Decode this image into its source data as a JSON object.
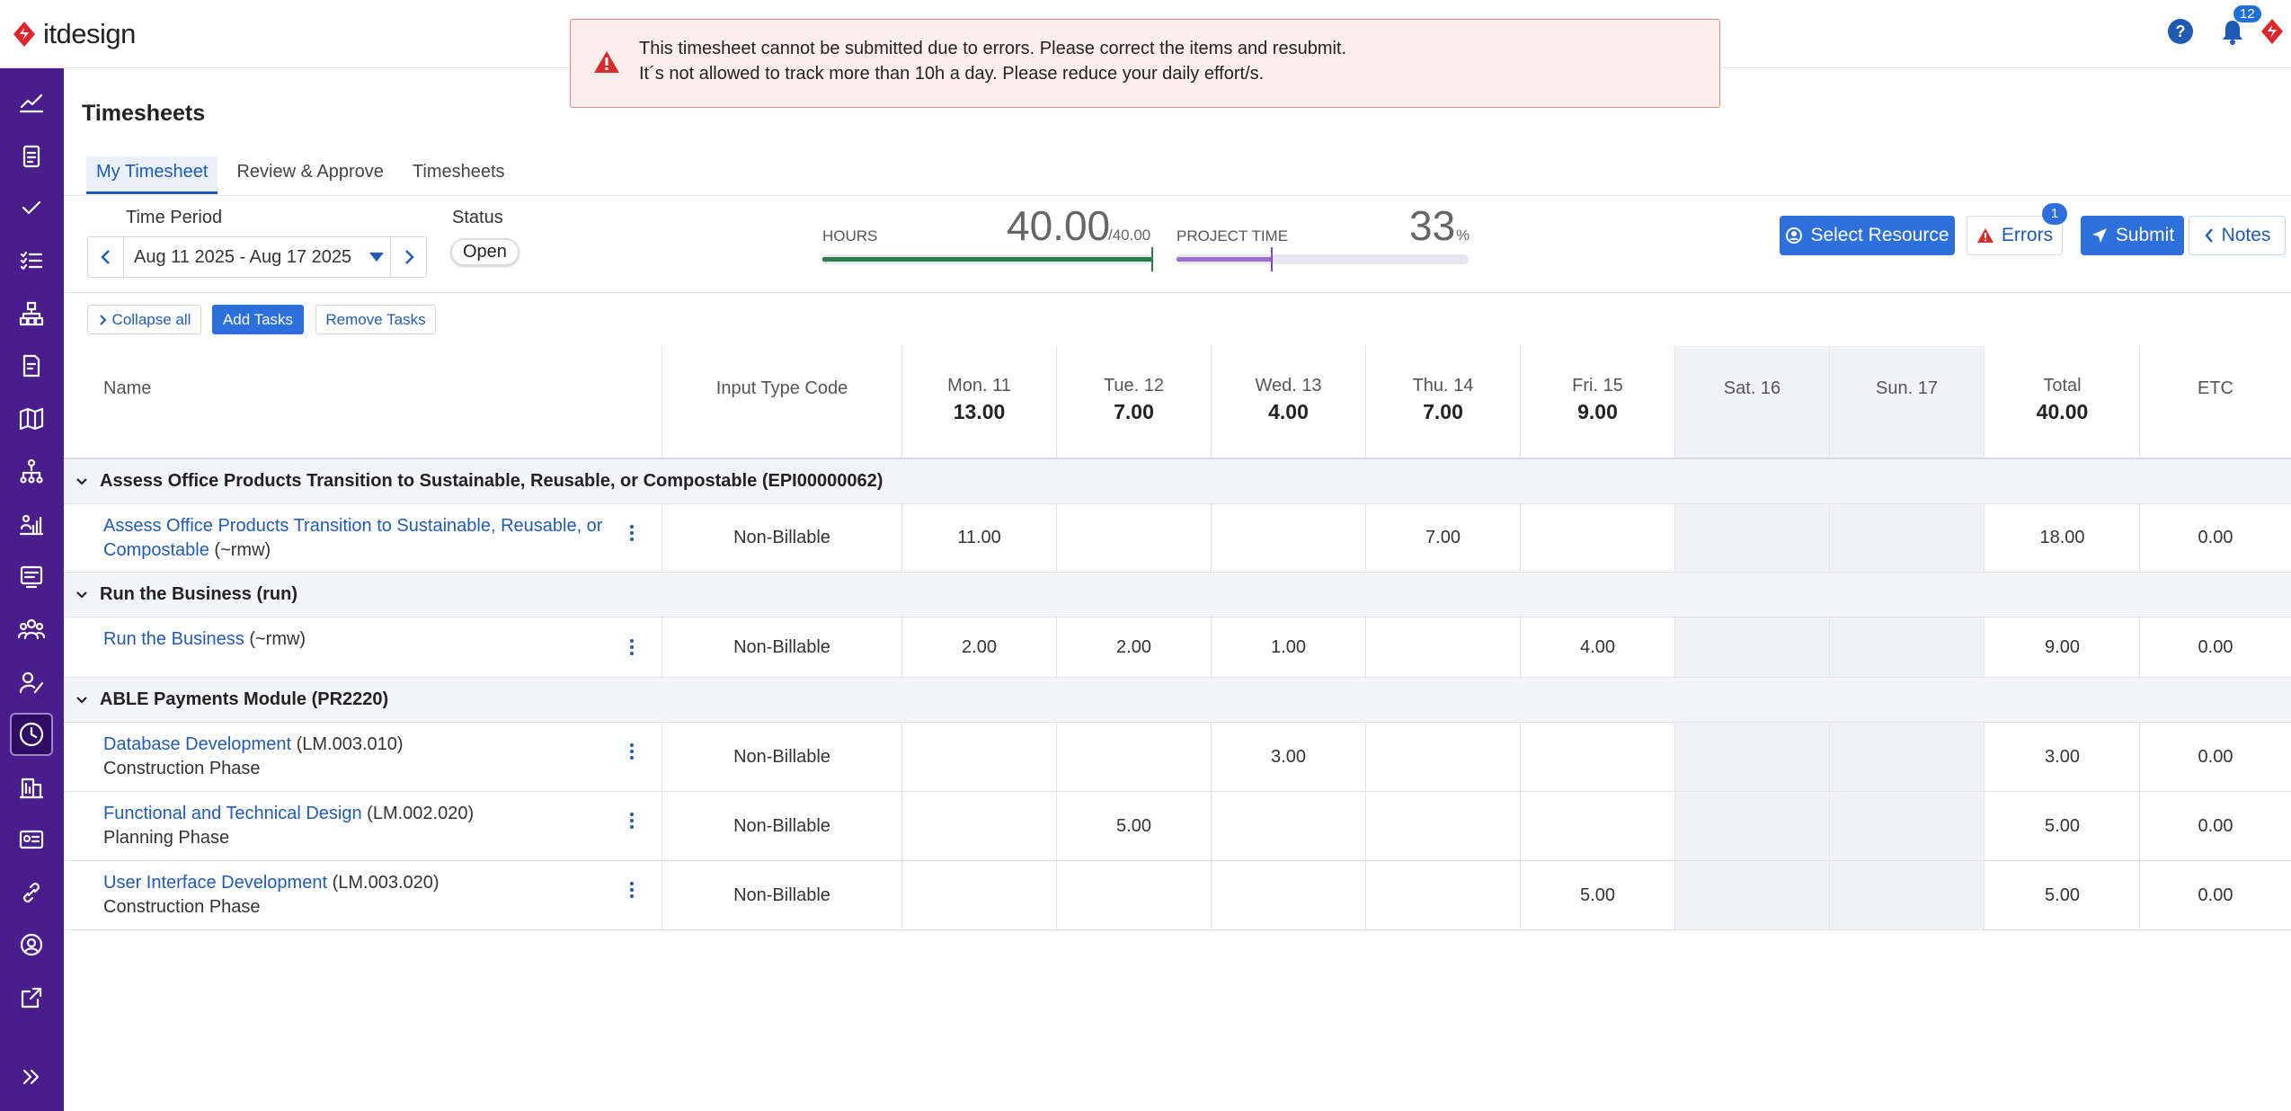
{
  "app": {
    "logo_text": "itdesign",
    "notification_count": "12"
  },
  "alert": {
    "line1": "This timesheet cannot be submitted due to errors. Please correct the items and resubmit.",
    "line2": "It´s not allowed to track more than 10h a day. Please reduce your daily effort/s."
  },
  "page": {
    "title": "Timesheets"
  },
  "tabs": [
    {
      "label": "My Timesheet",
      "active": true
    },
    {
      "label": "Review & Approve",
      "active": false
    },
    {
      "label": "Timesheets",
      "active": false
    }
  ],
  "controls": {
    "time_period_label": "Time Period",
    "time_period_value": "Aug 11 2025 - Aug 17 2025",
    "status_label": "Status",
    "status_value": "Open",
    "hours_label": "HOURS",
    "hours_value": "40.00",
    "hours_max": "/40.00",
    "hours_fraction": 1.0,
    "project_time_label": "PROJECT TIME",
    "project_time_value": "33",
    "project_time_unit": "%",
    "project_time_fraction": 0.33,
    "select_resource": "Select Resource",
    "errors": "Errors",
    "errors_count": "1",
    "submit": "Submit",
    "notes": "Notes",
    "collapse_all": "Collapse all",
    "add_tasks": "Add Tasks",
    "remove_tasks": "Remove Tasks"
  },
  "columns": {
    "name": "Name",
    "input_type": "Input Type Code",
    "days": [
      {
        "day": "Mon. 11",
        "total": "13.00"
      },
      {
        "day": "Tue. 12",
        "total": "7.00"
      },
      {
        "day": "Wed. 13",
        "total": "4.00"
      },
      {
        "day": "Thu. 14",
        "total": "7.00"
      },
      {
        "day": "Fri. 15",
        "total": "9.00"
      },
      {
        "day": "Sat. 16",
        "total": ""
      },
      {
        "day": "Sun. 17",
        "total": ""
      }
    ],
    "total": "Total",
    "total_value": "40.00",
    "etc": "ETC"
  },
  "groups": [
    {
      "title": "Assess Office Products Transition to Sustainable, Reusable, or Compostable (EPI00000062)",
      "tasks": [
        {
          "link_line1": "Assess Office Products Transition to Sustainable, Reusable, or",
          "link_line2": "Compostable",
          "code": "(~rmw)",
          "sub": "",
          "input_type": "Non-Billable",
          "hours": [
            "11.00",
            "",
            "",
            "7.00",
            "",
            "",
            ""
          ],
          "total": "18.00",
          "etc": "0.00"
        }
      ]
    },
    {
      "title": "Run the Business (run)",
      "tasks": [
        {
          "link_line1": "Run the Business",
          "link_line2": "",
          "code": "(~rmw)",
          "sub": "",
          "input_type": "Non-Billable",
          "hours": [
            "2.00",
            "2.00",
            "1.00",
            "",
            "4.00",
            "",
            ""
          ],
          "total": "9.00",
          "etc": "0.00"
        }
      ]
    },
    {
      "title": "ABLE Payments Module (PR2220)",
      "tasks": [
        {
          "link_line1": "Database Development",
          "link_line2": "",
          "code": "(LM.003.010)",
          "sub": "Construction Phase",
          "input_type": "Non-Billable",
          "hours": [
            "",
            "",
            "3.00",
            "",
            "",
            "",
            ""
          ],
          "total": "3.00",
          "etc": "0.00"
        },
        {
          "link_line1": "Functional and Technical Design",
          "link_line2": "",
          "code": "(LM.002.020)",
          "sub": "Planning Phase",
          "input_type": "Non-Billable",
          "hours": [
            "",
            "5.00",
            "",
            "",
            "",
            "",
            ""
          ],
          "total": "5.00",
          "etc": "0.00"
        },
        {
          "link_line1": "User Interface Development",
          "link_line2": "",
          "code": "(LM.003.020)",
          "sub": "Construction Phase",
          "input_type": "Non-Billable",
          "hours": [
            "",
            "",
            "",
            "",
            "5.00",
            "",
            ""
          ],
          "total": "5.00",
          "etc": "0.00"
        }
      ]
    }
  ],
  "colors": {
    "sidebar": "#4a1d8c",
    "primary": "#2d6fdb",
    "link": "#1f5bb5",
    "alert_bg": "#fdeeee",
    "error_red": "#d62d2d",
    "hours_bar": "#2e7d4f",
    "project_bar": "#9b6fd0"
  },
  "sidebar_icons": [
    "chart-line-icon",
    "clipboard-icon",
    "check-icon",
    "checklist-icon",
    "hierarchy-icon",
    "document-edit-icon",
    "map-icon",
    "org-chart-icon",
    "people-chart-icon",
    "report-icon",
    "team-icon",
    "user-edit-icon",
    "clock-icon",
    "building-chart-icon",
    "id-card-icon",
    "link-icon",
    "settings-user-icon",
    "external-link-icon",
    "expand-icon"
  ]
}
